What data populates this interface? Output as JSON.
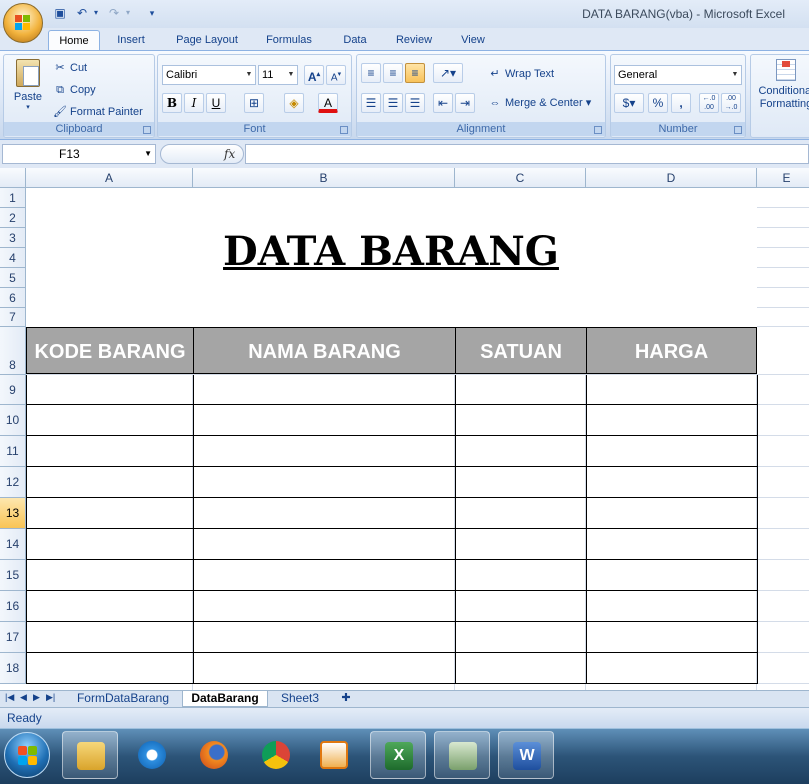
{
  "window": {
    "title": "DATA BARANG(vba)  -  Microsoft Excel"
  },
  "quick_access": [
    {
      "name": "save-icon",
      "glyph": "💾"
    },
    {
      "name": "undo-icon",
      "glyph": "↶"
    },
    {
      "name": "redo-icon",
      "glyph": "↷"
    },
    {
      "name": "customize-qat-icon",
      "glyph": "▾"
    }
  ],
  "ribbon_tabs": [
    "Home",
    "Insert",
    "Page Layout",
    "Formulas",
    "Data",
    "Review",
    "View"
  ],
  "active_tab": "Home",
  "ribbon": {
    "clipboard": {
      "label": "Clipboard",
      "paste": "Paste",
      "cut": "Cut",
      "copy": "Copy",
      "format_painter": "Format Painter"
    },
    "font": {
      "label": "Font",
      "family": "Calibri",
      "size": "11",
      "bold": "B",
      "italic": "I",
      "underline": "U"
    },
    "alignment": {
      "label": "Alignment",
      "wrap_text": "Wrap Text",
      "merge_center": "Merge & Center"
    },
    "number": {
      "label": "Number",
      "format": "General",
      "percent": "%",
      "comma": ",",
      "inc_decimal": "←.0 .00",
      "dec_decimal": ".00 →.0"
    },
    "styles": {
      "conditional_formatting_line1": "Conditional",
      "conditional_formatting_line2": "Formatting"
    }
  },
  "formula_bar": {
    "name_box": "F13",
    "fx": "fx",
    "formula": ""
  },
  "columns": [
    "A",
    "B",
    "C",
    "D",
    "E"
  ],
  "rows": [
    "1",
    "2",
    "3",
    "4",
    "5",
    "6",
    "7",
    "8",
    "9",
    "10",
    "11",
    "12",
    "13",
    "14",
    "15",
    "16",
    "17",
    "18"
  ],
  "active_row": "13",
  "sheet": {
    "title": "DATA BARANG",
    "headers": [
      "KODE BARANG",
      "NAMA BARANG",
      "SATUAN",
      "HARGA"
    ],
    "header_fill": "#a5a5a5"
  },
  "sheet_tabs": [
    "FormDataBarang",
    "DataBarang",
    "Sheet3"
  ],
  "active_sheet": "DataBarang",
  "status": "Ready",
  "taskbar": [
    "file-explorer-icon",
    "internet-explorer-icon",
    "firefox-icon",
    "chrome-icon",
    "media-player-icon",
    "excel-icon",
    "app-icon",
    "word-icon"
  ]
}
